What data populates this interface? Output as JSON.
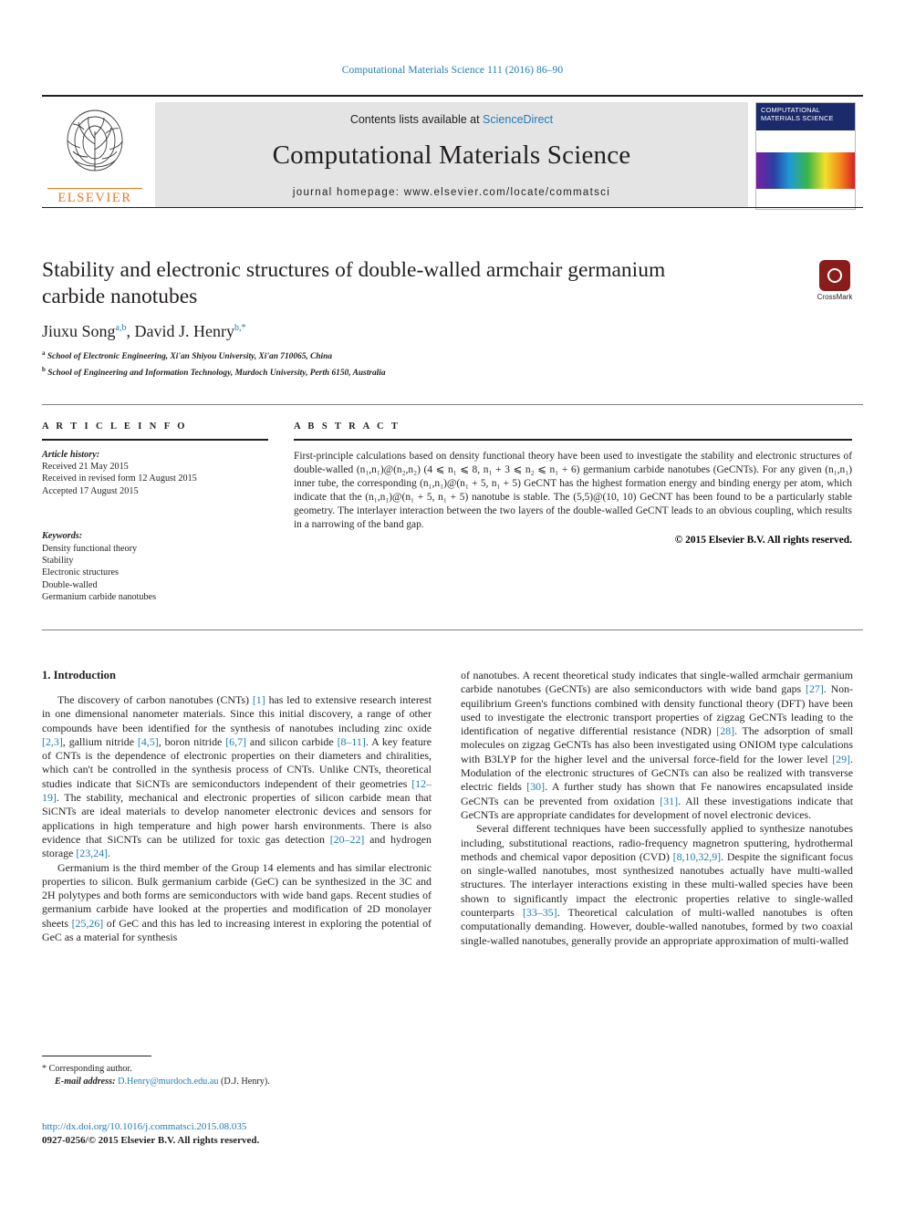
{
  "running_head": "Computational Materials Science 111 (2016) 86–90",
  "masthead": {
    "contents_prefix": "Contents lists available at ",
    "sciencedirect": "ScienceDirect",
    "journal_title": "Computational Materials Science",
    "homepage": "journal homepage: www.elsevier.com/locate/commatsci",
    "publisher": "ELSEVIER",
    "cover_title_lines": "COMPUTATIONAL MATERIALS SCIENCE"
  },
  "crossmark": {
    "label": "CrossMark"
  },
  "article": {
    "title": "Stability and electronic structures of double-walled armchair germanium carbide nanotubes",
    "authors_html": "Jiuxu Song <sup>a,b</sup>, David J. Henry <sup>b,*</sup>",
    "affiliation_a": "School of Electronic Engineering, Xi'an Shiyou University, Xi'an 710065, China",
    "affiliation_b": "School of Engineering and Information Technology, Murdoch University, Perth 6150, Australia"
  },
  "article_info": {
    "heading": "A R T I C L E   I N F O",
    "history_label": "Article history:",
    "history": [
      "Received 21 May 2015",
      "Received in revised form 12 August 2015",
      "Accepted 17 August 2015"
    ],
    "keywords_label": "Keywords:",
    "keywords": [
      "Density functional theory",
      "Stability",
      "Electronic structures",
      "Double-walled",
      "Germanium carbide nanotubes"
    ]
  },
  "abstract": {
    "heading": "A B S T R A C T",
    "text": "First-principle calculations based on density functional theory have been used to investigate the stability and electronic structures of double-walled (n₁,n₁)@(n₂,n₂) (4 ⩽ n₁ ⩽ 8, n₁ + 3 ⩽ n₂ ⩽ n₁ + 6) germanium carbide nanotubes (GeCNTs). For any given (n₁,n₁) inner tube, the corresponding (n₁,n₁)@(n₁ + 5, n₁ + 5) GeCNT has the highest formation energy and binding energy per atom, which indicate that the (n₁,n₁)@(n₁ + 5, n₁ + 5) nanotube is stable. The (5,5)@(10, 10) GeCNT has been found to be a particularly stable geometry. The interlayer interaction between the two layers of the double-walled GeCNT leads to an obvious coupling, which results in a narrowing of the band gap.",
    "copyright": "© 2015 Elsevier B.V. All rights reserved."
  },
  "body": {
    "section_heading": "1. Introduction",
    "left_paragraphs": [
      "The discovery of carbon nanotubes (CNTs) [1] has led to extensive research interest in one dimensional nanometer materials. Since this initial discovery, a range of other compounds have been identified for the synthesis of nanotubes including zinc oxide [2,3], gallium nitride [4,5], boron nitride [6,7] and silicon carbide [8–11]. A key feature of CNTs is the dependence of electronic properties on their diameters and chiralities, which can't be controlled in the synthesis process of CNTs. Unlike CNTs, theoretical studies indicate that SiCNTs are semiconductors independent of their geometries [12–19]. The stability, mechanical and electronic properties of silicon carbide mean that SiCNTs are ideal materials to develop nanometer electronic devices and sensors for applications in high temperature and high power harsh environments. There is also evidence that SiCNTs can be utilized for toxic gas detection [20–22] and hydrogen storage [23,24].",
      "Germanium is the third member of the Group 14 elements and has similar electronic properties to silicon. Bulk germanium carbide (GeC) can be synthesized in the 3C and 2H polytypes and both forms are semiconductors with wide band gaps. Recent studies of germanium carbide have looked at the properties and modification of 2D monolayer sheets [25,26] of GeC and this has led to increasing interest in exploring the potential of GeC as a material for synthesis"
    ],
    "right_paragraphs": [
      "of nanotubes. A recent theoretical study indicates that single-walled armchair germanium carbide nanotubes (GeCNTs) are also semiconductors with wide band gaps [27]. Non-equilibrium Green's functions combined with density functional theory (DFT) have been used to investigate the electronic transport properties of zigzag GeCNTs leading to the identification of negative differential resistance (NDR) [28]. The adsorption of small molecules on zigzag GeCNTs has also been investigated using ONIOM type calculations with B3LYP for the higher level and the universal force-field for the lower level [29]. Modulation of the electronic structures of GeCNTs can also be realized with transverse electric fields [30]. A further study has shown that Fe nanowires encapsulated inside GeCNTs can be prevented from oxidation [31]. All these investigations indicate that GeCNTs are appropriate candidates for development of novel electronic devices.",
      "Several different techniques have been successfully applied to synthesize nanotubes including, substitutional reactions, radio-frequency magnetron sputtering, hydrothermal methods and chemical vapor deposition (CVD) [8,10,32,9]. Despite the significant focus on single-walled nanotubes, most synthesized nanotubes actually have multi-walled structures. The interlayer interactions existing in these multi-walled species have been shown to significantly impact the electronic properties relative to single-walled counterparts [33–35]. Theoretical calculation of multi-walled nanotubes is often computationally demanding. However, double-walled nanotubes, formed by two coaxial single-walled nanotubes, generally provide an appropriate approximation of multi-walled"
    ]
  },
  "footnotes": {
    "corresponding_marker": "*",
    "corresponding_text": "Corresponding author.",
    "email_label": "E-mail address:",
    "email": "D.Henry@murdoch.edu.au",
    "email_suffix": "(D.J. Henry)."
  },
  "footer": {
    "doi": "http://dx.doi.org/10.1016/j.commatsci.2015.08.035",
    "issn_line": "0927-0256/© 2015 Elsevier B.V. All rights reserved."
  },
  "colors": {
    "link": "#1f7bb6",
    "elsevier_orange": "#e87722",
    "crossmark_red": "#8a1c1c"
  }
}
